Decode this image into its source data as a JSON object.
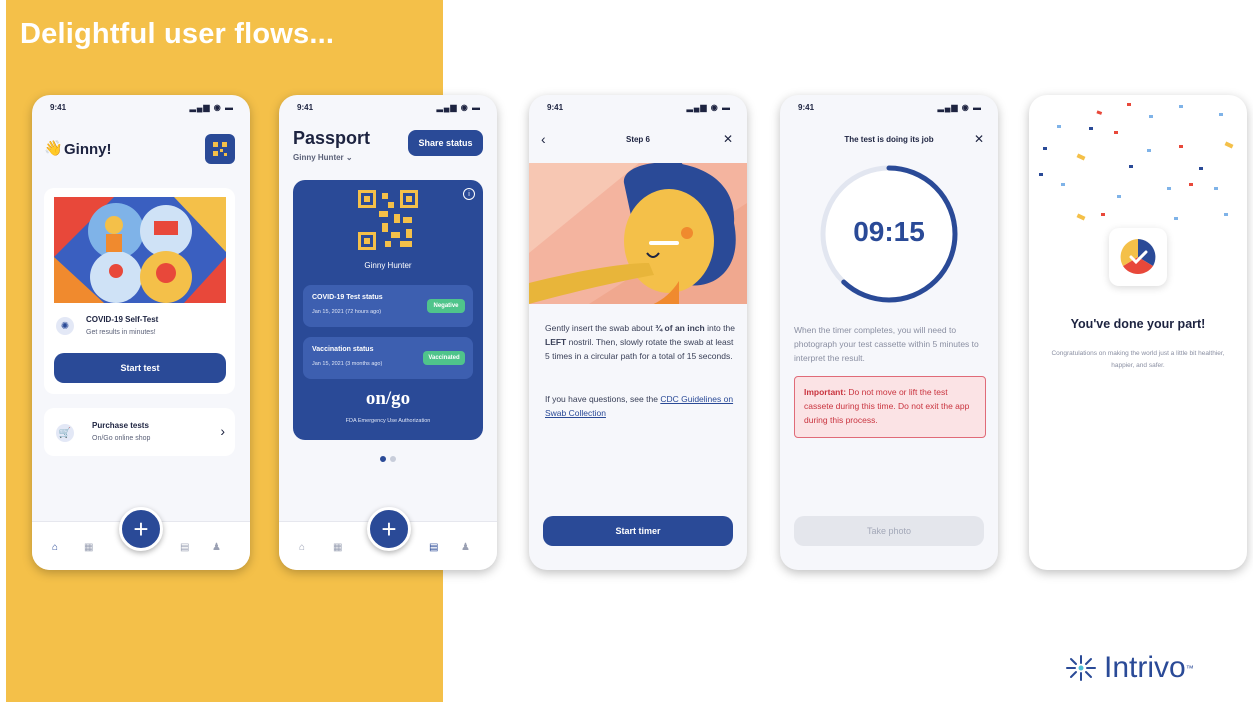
{
  "slide": {
    "title": "Delightful user flows...",
    "brand": "Intrivo",
    "trademark": "™",
    "accent_yellow": "#f4c049",
    "brand_blue": "#2a4a97"
  },
  "status": {
    "time": "9:41",
    "icons": "signal-wifi-battery"
  },
  "home": {
    "greeting": "Ginny!",
    "test_title": "COVID-19 Self-Test",
    "test_sub": "Get results in minutes!",
    "start_btn": "Start test",
    "purchase_title": "Purchase tests",
    "purchase_sub": "On/Go online shop"
  },
  "passport": {
    "title": "Passport",
    "user": "Ginny Hunter",
    "share_btn": "Share status",
    "qr_name": "Ginny Hunter",
    "covid_title": "COVID-19 Test status",
    "covid_date": "Jan 15, 2021 (72 hours ago)",
    "covid_badge": "Negative",
    "vax_title": "Vaccination status",
    "vax_date": "Jan 15, 2021 (3 months ago)",
    "vax_badge": "Vaccinated",
    "logo": "on/go",
    "fda": "FDA Emergency Use Authorization"
  },
  "step": {
    "title": "Step 6",
    "instr_1": "Gently insert the swab about",
    "instr_bold1": "¾ of an inch",
    "instr_2": "into the",
    "instr_bold2": "LEFT",
    "instr_3": "nostril. Then, slowly rotate the swab at least 5 times in a circular path for a total of 15 seconds.",
    "questions": "If you have questions, see the",
    "link": "CDC Guidelines on Swab Collection",
    "btn": "Start timer"
  },
  "timer": {
    "title": "The test is doing its job",
    "time": "09:15",
    "progress": 0.62,
    "desc": "When the timer completes, you will need to photograph your test cassette within 5 minutes to interpret the result.",
    "imp_label": "Important:",
    "imp_text": "Do not move or lift the test cassete during this time. Do not exit the app during this process.",
    "btn": "Take photo"
  },
  "done": {
    "title": "You've done your part!",
    "text": "Congratulations on making the world just a little bit healthier, happier, and safer."
  }
}
